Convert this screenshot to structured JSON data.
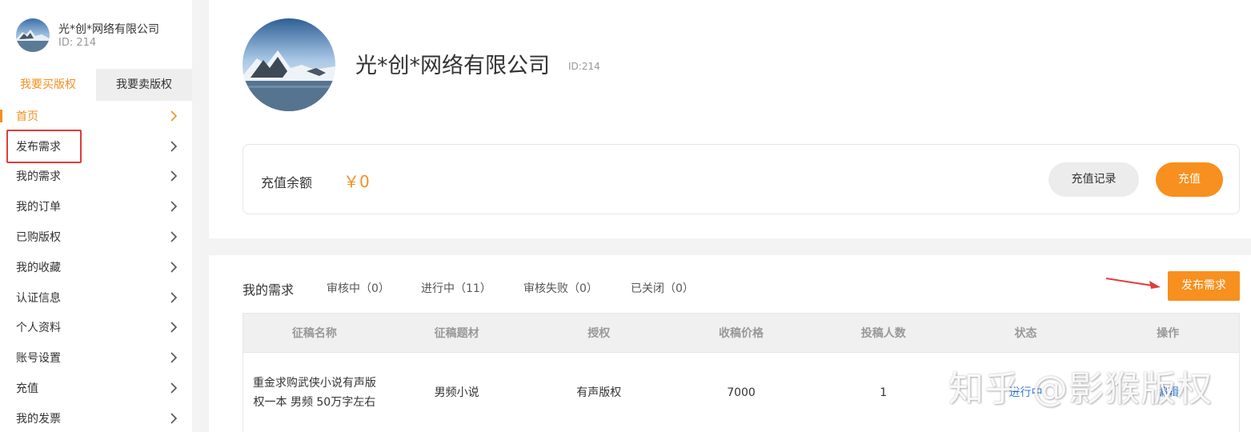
{
  "user": {
    "name": "光*创*网络有限公司",
    "id_text": "ID:   214"
  },
  "tabs": {
    "buy": "我要买版权",
    "sell": "我要卖版权"
  },
  "menu": [
    {
      "label": "首页",
      "active": true
    },
    {
      "label": "发布需求",
      "active": false
    },
    {
      "label": "我的需求",
      "active": false
    },
    {
      "label": "我的订单",
      "active": false
    },
    {
      "label": "已购版权",
      "active": false
    },
    {
      "label": "我的收藏",
      "active": false
    },
    {
      "label": "认证信息",
      "active": false
    },
    {
      "label": "个人资料",
      "active": false
    },
    {
      "label": "账号设置",
      "active": false
    },
    {
      "label": "充值",
      "active": false
    },
    {
      "label": "我的发票",
      "active": false
    }
  ],
  "profile": {
    "company": "光*创*网络有限公司",
    "id_text": "ID:214"
  },
  "balance": {
    "label": "充值余额",
    "value": "￥0",
    "record_button": "充值记录",
    "charge_button": "充值"
  },
  "demands": {
    "title": "我的需求",
    "filters": [
      "审核中（0）",
      "进行中（11）",
      "审核失败（0）",
      "已关闭（0）"
    ],
    "publish_button": "发布需求",
    "columns": [
      "征稿名称",
      "征稿题材",
      "授权",
      "收稿价格",
      "投稿人数",
      "状态",
      "操作"
    ],
    "rows": [
      {
        "name": "重金求购武侠小说有声版权一本 男频 50万字左右",
        "genre": "男频小说",
        "license": "有声版权",
        "price": "7000",
        "submitters": "1",
        "status": "进行中",
        "ops": "编辑"
      }
    ]
  },
  "watermark": "知乎 @影猴版权",
  "colors": {
    "accent": "#f7901e",
    "highlight_box": "#e23b3b",
    "link": "#3a7bd5"
  }
}
